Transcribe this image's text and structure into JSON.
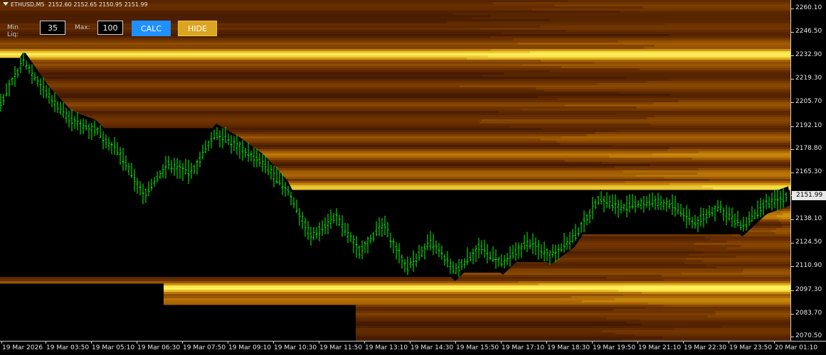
{
  "header": {
    "symbol": "ETHUSD,M5",
    "ohlc": "2152.60 2152.65 2150.95 2151.99"
  },
  "controls": {
    "min_label": "Min Liq:",
    "min_value": "35",
    "max_label": "Max:",
    "max_value": "100",
    "calc_label": "CALC",
    "hide_label": "HIDE"
  },
  "colors": {
    "calc_button": "#1e90ff",
    "hide_button": "#daa520",
    "candle": "#00ff00",
    "heat_low": "#3a1000",
    "heat_high": "#ffee55"
  },
  "chart_data": {
    "type": "line",
    "title": "",
    "series": [
      {
        "name": "",
        "x": [
          "19 Mar 2026",
          "19 Mar 03:00",
          "19 Mar 04:00",
          "19 Mar 05:00",
          "19 Mar 06:00",
          "19 Mar 06:45",
          "19 Mar 07:15",
          "19 Mar 08:00",
          "19 Mar 08:45",
          "19 Mar 09:30",
          "19 Mar 10:30",
          "19 Mar 11:15",
          "19 Mar 11:50",
          "19 Mar 12:10",
          "19 Mar 12:40",
          "19 Mar 13:10",
          "19 Mar 13:40",
          "19 Mar 14:10",
          "19 Mar 14:40",
          "19 Mar 15:10",
          "19 Mar 15:40",
          "19 Mar 16:20",
          "19 Mar 17:00",
          "19 Mar 17:40",
          "19 Mar 18:10",
          "19 Mar 18:30",
          "19 Mar 19:20",
          "19 Mar 20:20",
          "19 Mar 21:10",
          "19 Mar 21:40",
          "19 Mar 22:40",
          "19 Mar 23:20",
          "20 Mar 00:20",
          "20 Mar 01:10"
        ],
        "values": [
          2205,
          2230,
          2210,
          2195,
          2190,
          2176,
          2152,
          2170,
          2165,
          2188,
          2180,
          2170,
          2155,
          2128,
          2140,
          2120,
          2135,
          2110,
          2125,
          2108,
          2122,
          2112,
          2125,
          2118,
          2128,
          2150,
          2145,
          2148,
          2147,
          2136,
          2145,
          2134,
          2147,
          2152
        ]
      }
    ],
    "yticks": [
      "2260.10",
      "2246.50",
      "2232.90",
      "2219.30",
      "2205.70",
      "2192.10",
      "2178.80",
      "2165.30",
      "2151.99",
      "2138.10",
      "2124.50",
      "2110.90",
      "2097.30",
      "2083.70",
      "2070.50"
    ],
    "xticks": [
      "19 Mar 2026",
      "19 Mar 03:50",
      "19 Mar 05:10",
      "19 Mar 06:30",
      "19 Mar 07:50",
      "19 Mar 09:10",
      "19 Mar 10:30",
      "19 Mar 11:50",
      "19 Mar 13:10",
      "19 Mar 14:30",
      "19 Mar 15:50",
      "19 Mar 17:10",
      "19 Mar 18:30",
      "19 Mar 19:50",
      "19 Mar 21:10",
      "19 Mar 22:30",
      "19 Mar 23:50",
      "20 Mar 01:10"
    ],
    "ylim": [
      2068,
      2265
    ],
    "current_price": "2151.99"
  }
}
